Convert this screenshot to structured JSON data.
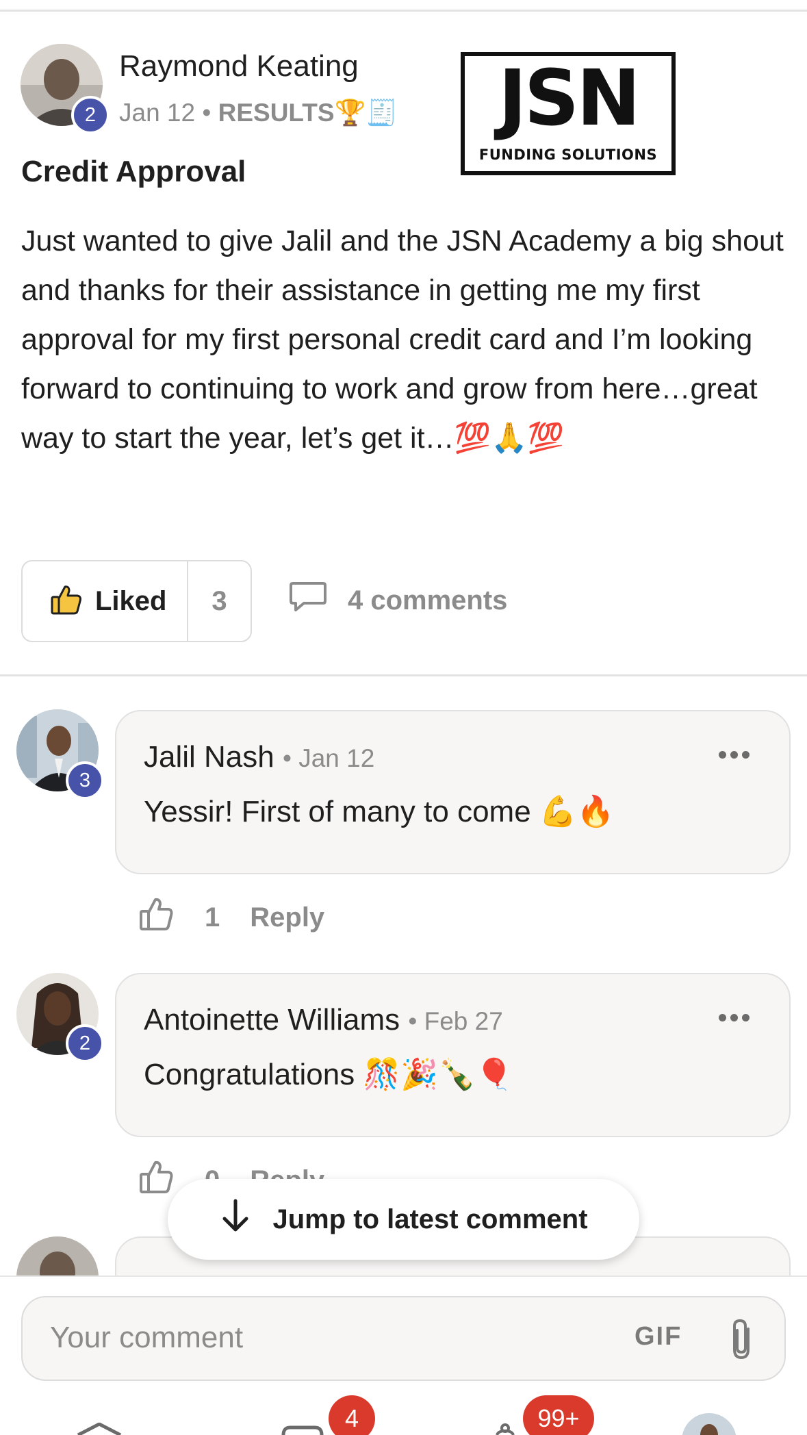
{
  "post": {
    "author": {
      "name": "Raymond Keating",
      "level": "2"
    },
    "date": "Jan 12",
    "separator": "•",
    "category": "RESULTS🏆🧾",
    "title": "Credit Approval",
    "logo": {
      "text": "JSN",
      "subtext": "FUNDING SOLUTIONS"
    },
    "body": "Just wanted to give Jalil and the JSN Academy a big shout and thanks for their assistance in getting me my first approval for my first personal credit card and I’m looking forward to continuing to work and grow from here…great way to start the year, let’s get it…💯🙏💯",
    "like_label": "Liked",
    "like_count": "3",
    "comments_label": "4 comments"
  },
  "comments": [
    {
      "name": "Jalil Nash",
      "date": "• Jan 12",
      "level": "3",
      "text": "Yessir! First of many to come 💪🔥",
      "likes": "1",
      "reply_label": "Reply"
    },
    {
      "name": "Antoinette Williams",
      "date": "• Feb 27",
      "level": "2",
      "text": "Congratulations 🎊🎉🍾🎈",
      "likes": "0",
      "reply_label": "Reply"
    }
  ],
  "jump_label": "Jump to latest comment",
  "composer": {
    "placeholder": "Your comment",
    "gif_label": "GIF"
  },
  "nav_badges": {
    "chat": "4",
    "notifications": "99+"
  },
  "colors": {
    "level_badge": "#4653a8",
    "notification_badge": "#d93a2b",
    "like_icon": "#f5c542"
  }
}
